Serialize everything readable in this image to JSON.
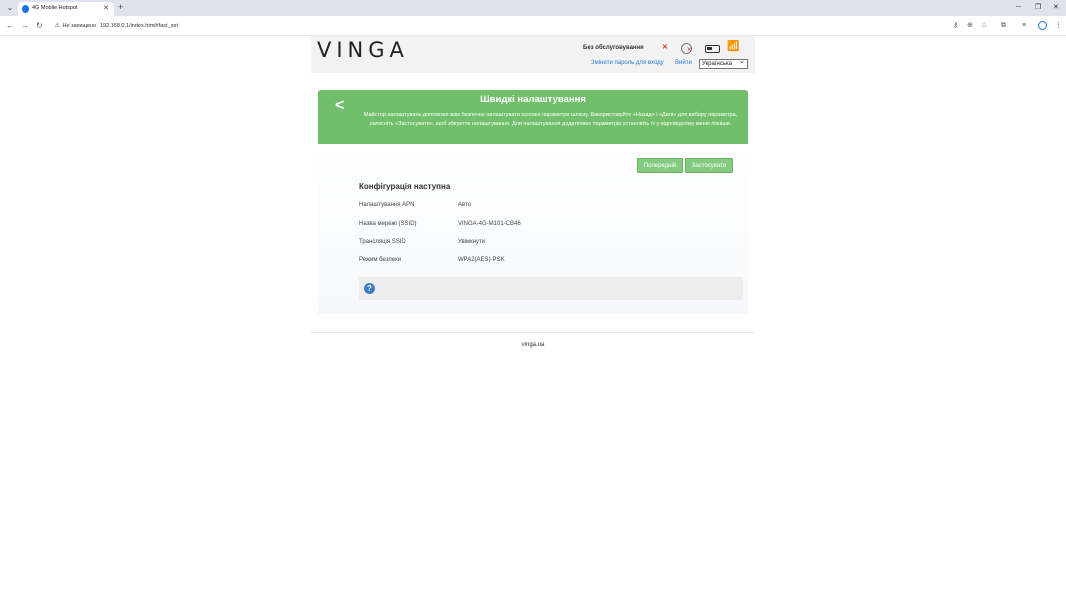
{
  "browser": {
    "tab_title": "4G Mobile Hotspot",
    "insecure_label": "Не захищено",
    "url": "192.168.0.1/index.html#fast_set"
  },
  "header": {
    "logo": "VINGA",
    "network_status": "Без обслуговування",
    "change_password": "Змінити пароль для входу",
    "logout": "Вийти",
    "language": "Українська"
  },
  "wizard": {
    "title": "Швидкі налаштування",
    "description": "Майстор налаштувань допоможе вам безпечно налаштувати основні параметри шлюзу. Використовуйте «Назад» і «Далі» для вибору параметра, натисніть «Застосувати», щоб зберегти налаштування. Для налаштування додаткових параметрів установіть їх у відповідному меню пізніше.",
    "prev_button": "Попередній",
    "apply_button": "Застосувати",
    "section_title": "Конфігурація наступна",
    "rows": [
      {
        "label": "Налаштування APN",
        "value": "Авто"
      },
      {
        "label": "Назва мережі (SSID)",
        "value": "VINGA-4G-M101-CB46"
      },
      {
        "label": "Трансляція SSID",
        "value": "Увімкнути"
      },
      {
        "label": "Режим безпеки",
        "value": "WPA2(AES)-PSK"
      }
    ]
  },
  "footer": {
    "site": "vinga.ua"
  }
}
